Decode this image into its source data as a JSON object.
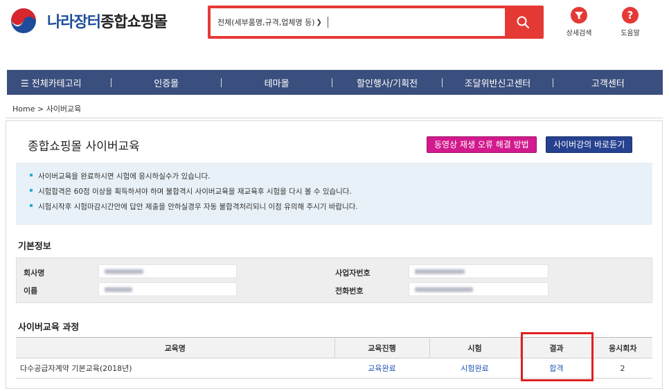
{
  "header": {
    "logo_blue": "나라장터",
    "logo_dark": "종합쇼핑몰",
    "search": {
      "scope": "전체(세부품명,규격,업체명 등)",
      "value": "",
      "placeholder": ""
    },
    "tools": [
      {
        "label": "상세검색",
        "icon": "filter-icon"
      },
      {
        "label": "도움말",
        "icon": "help-icon"
      }
    ]
  },
  "nav": {
    "menu_icon": "☰",
    "items": [
      "전체카테고리",
      "인증몰",
      "테마몰",
      "할인행사/기획전",
      "조달위반신고센터",
      "고객센터"
    ]
  },
  "breadcrumb": "Home > 사이버교육",
  "main": {
    "title": "종합쇼핑몰 사이버교육",
    "buttons": {
      "video_help": "동영상 재생 오류 해결 방법",
      "direct_lecture": "사이버강의 바로듣기"
    },
    "notices": [
      "사이버교육을 완료하시면 시험에 응시하실수가 있습니다.",
      "시험합격은 60점 이상을 획득하셔야 하며 불합격시 사이버교육을 재교육후 시험을 다시 볼 수 있습니다.",
      "시험시작후 시험마감시간안에 답안 제출을 안하실경우 자동 불합격처리되니 이점 유의해 주시기 바랍니다."
    ],
    "basic_info": {
      "heading": "기본정보",
      "company_label": "회사명",
      "name_label": "이름",
      "biz_no_label": "사업자번호",
      "phone_label": "전화번호"
    },
    "courses": {
      "heading": "사이버교육 과정",
      "columns": [
        "교육명",
        "교육진행",
        "시험",
        "결과",
        "응시회차"
      ],
      "rows": [
        {
          "name": "다수공급자계약 기본교육(2018년)",
          "progress": "교육완료",
          "exam": "시험완료",
          "result": "합격",
          "attempts": "2"
        }
      ]
    }
  },
  "colors": {
    "accent_red": "#e53935",
    "nav_bg": "#3b4f7e",
    "pink_button": "#d2198d",
    "navy_button": "#26418f",
    "link_blue": "#1e56b3"
  }
}
